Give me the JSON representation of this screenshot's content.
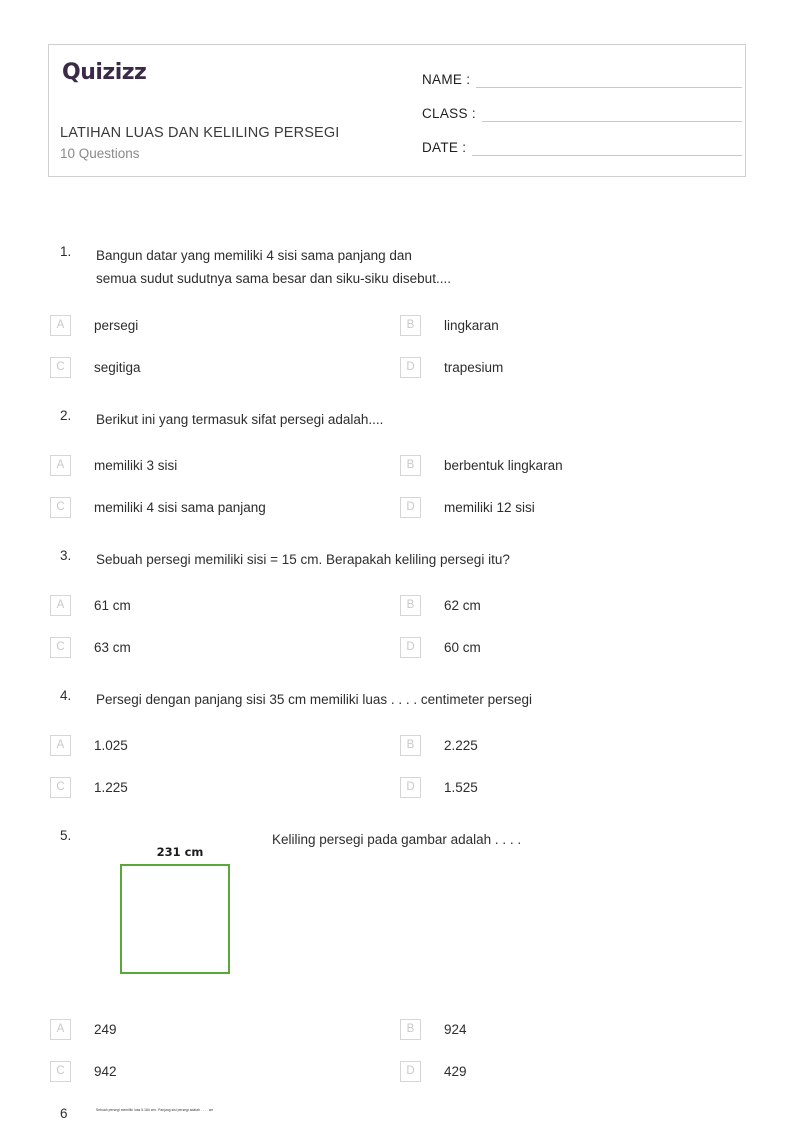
{
  "header": {
    "logo_text": "Quizizz",
    "title": "LATIHAN LUAS DAN KELILING PERSEGI",
    "subtitle": "10 Questions",
    "fields": [
      {
        "label": "NAME :",
        "value": ""
      },
      {
        "label": "CLASS :",
        "value": ""
      },
      {
        "label": "DATE  :",
        "value": ""
      }
    ]
  },
  "questions": [
    {
      "number": "1.",
      "line1": "Bangun datar yang memiliki 4 sisi sama panjang dan",
      "line2": "semua sudut sudutnya sama besar dan siku-siku disebut....",
      "options": [
        {
          "letter": "A",
          "text": "persegi"
        },
        {
          "letter": "B",
          "text": "lingkaran"
        },
        {
          "letter": "C",
          "text": "segitiga"
        },
        {
          "letter": "D",
          "text": "trapesium"
        }
      ]
    },
    {
      "number": "2.",
      "line1": "Berikut ini yang termasuk sifat persegi adalah....",
      "line2": "",
      "options": [
        {
          "letter": "A",
          "text": "memiliki 3 sisi"
        },
        {
          "letter": "B",
          "text": "berbentuk lingkaran"
        },
        {
          "letter": "C",
          "text": "memiliki 4 sisi sama panjang"
        },
        {
          "letter": "D",
          "text": "memiliki 12 sisi"
        }
      ]
    },
    {
      "number": "3.",
      "line1": "Sebuah persegi memiliki sisi = 15 cm. Berapakah keliling persegi itu?",
      "line2": "",
      "options": [
        {
          "letter": "A",
          "text": "61 cm"
        },
        {
          "letter": "B",
          "text": "62 cm"
        },
        {
          "letter": "C",
          "text": "63 cm"
        },
        {
          "letter": "D",
          "text": "60 cm"
        }
      ]
    },
    {
      "number": "4.",
      "line1": "Persegi dengan panjang sisi 35 cm memiliki luas . . . . centimeter persegi",
      "line2": "",
      "options": [
        {
          "letter": "A",
          "text": "1.025"
        },
        {
          "letter": "B",
          "text": "2.225"
        },
        {
          "letter": "C",
          "text": "1.225"
        },
        {
          "letter": "D",
          "text": "1.525"
        }
      ]
    },
    {
      "number": "5.",
      "line1": "Keliling persegi pada gambar adalah . . . .",
      "line2": "",
      "figure": {
        "label": "231 cm",
        "shape": "square",
        "border_color": "#5aa83c"
      },
      "options": [
        {
          "letter": "A",
          "text": "249"
        },
        {
          "letter": "B",
          "text": "924"
        },
        {
          "letter": "C",
          "text": "942"
        },
        {
          "letter": "D",
          "text": "429"
        }
      ]
    },
    {
      "number": "6",
      "line1": "Sebuah persegi memiliki luas 5.184 cm². Panjang sisi persegi adalah . . . . cm",
      "line2": "",
      "options": []
    }
  ],
  "colors": {
    "logo": "#3b2a47",
    "figure_green": "#5aa83c",
    "border_gray": "#cfcfcf",
    "option_letter": "#c9c9c9",
    "subtitle_gray": "#8a8a8a"
  }
}
